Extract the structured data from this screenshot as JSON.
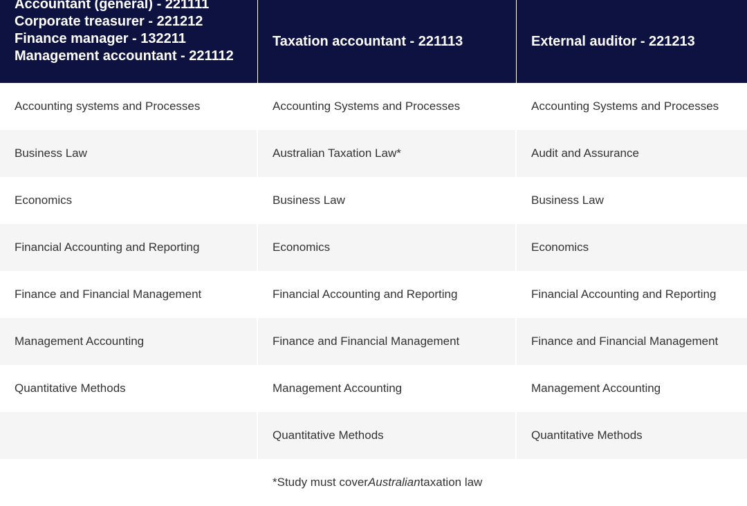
{
  "header": {
    "col1_lines": [
      "Accountant (general) - 221111",
      "Corporate treasurer - 221212",
      "Finance manager - 132211",
      "Management accountant - 221112"
    ],
    "col2": "Taxation accountant - 221113",
    "col3": "External auditor - 221213"
  },
  "rows": [
    [
      "Accounting systems and Processes",
      "Accounting Systems and Processes",
      "Accounting Systems and Processes"
    ],
    [
      "Business Law",
      "Australian Taxation Law*",
      "Audit and Assurance"
    ],
    [
      "Economics",
      "Business Law",
      "Business Law"
    ],
    [
      "Financial Accounting and Reporting",
      "Economics",
      "Economics"
    ],
    [
      "Finance and Financial Management",
      "Financial Accounting and Reporting",
      "Financial Accounting and Reporting"
    ],
    [
      "Management Accounting",
      "Finance and Financial Management",
      "Finance and Financial Management"
    ],
    [
      "Quantitative Methods",
      "Management Accounting",
      "Management Accounting"
    ],
    [
      "",
      "Quantitative Methods",
      "Quantitative Methods"
    ]
  ],
  "footnote": {
    "prefix": "*Study must cover ",
    "emphasis": "Australian",
    "suffix": " taxation law"
  }
}
